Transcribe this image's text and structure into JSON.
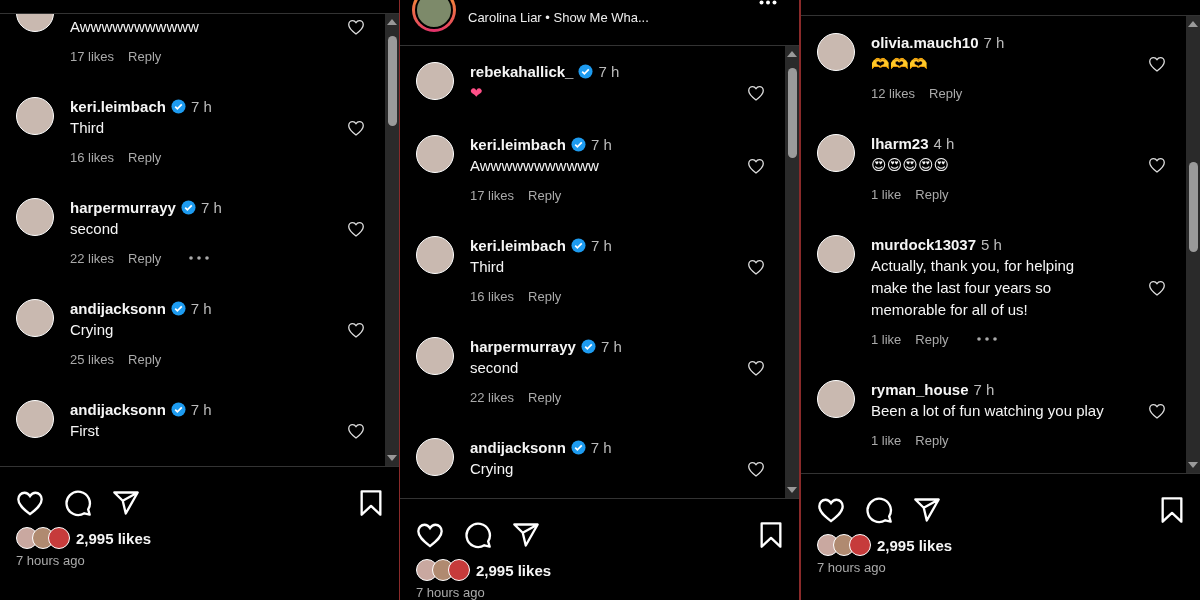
{
  "panels": [
    {
      "comments": [
        {
          "text": "Awwwwwwwwwww",
          "likes": "17 likes",
          "reply": "Reply",
          "more": false
        },
        {
          "user": "keri.leimbach",
          "verified": true,
          "time": "7 h",
          "text": "Third",
          "likes": "16 likes",
          "reply": "Reply",
          "more": false
        },
        {
          "user": "harpermurrayy",
          "verified": true,
          "time": "7 h",
          "text": "second",
          "likes": "22 likes",
          "reply": "Reply",
          "more": true
        },
        {
          "user": "andijacksonn",
          "verified": true,
          "time": "7 h",
          "text": "Crying",
          "likes": "25 likes",
          "reply": "Reply",
          "more": false
        },
        {
          "user": "andijacksonn",
          "verified": true,
          "time": "7 h",
          "text": "First"
        }
      ],
      "likes": "2,995 likes",
      "posted": "7 hours ago"
    },
    {
      "header": {
        "subtitle": "Carolina Liar • Show Me Wha..."
      },
      "comments": [
        {
          "user": "rebekahallick_",
          "verified": true,
          "time": "7 h",
          "text": "❤"
        },
        {
          "user": "keri.leimbach",
          "verified": true,
          "time": "7 h",
          "text": "Awwwwwwwwwww",
          "likes": "17 likes",
          "reply": "Reply",
          "more": false
        },
        {
          "user": "keri.leimbach",
          "verified": true,
          "time": "7 h",
          "text": "Third",
          "likes": "16 likes",
          "reply": "Reply",
          "more": false
        },
        {
          "user": "harpermurrayy",
          "verified": true,
          "time": "7 h",
          "text": "second",
          "likes": "22 likes",
          "reply": "Reply",
          "more": false
        },
        {
          "user": "andijacksonn",
          "verified": true,
          "time": "7 h",
          "text": "Crying"
        }
      ],
      "likes": "2,995 likes",
      "posted": "7 hours ago"
    },
    {
      "comments": [
        {
          "user": "olivia.mauch10",
          "verified": false,
          "time": "7 h",
          "text": "🫶🫶🫶",
          "likes": "12 likes",
          "reply": "Reply",
          "more": false
        },
        {
          "user": "lharm23",
          "verified": false,
          "time": "4 h",
          "text": "😍😍😍😍😍",
          "likes": "1 like",
          "reply": "Reply",
          "more": false
        },
        {
          "user": "murdock13037",
          "verified": false,
          "time": "5 h",
          "text": "Actually, thank you, for helping make the last four years so memorable for all of us!",
          "likes": "1 like",
          "reply": "Reply",
          "more": true
        },
        {
          "user": "ryman_house",
          "verified": false,
          "time": "7 h",
          "text": "Been a lot of fun watching you play",
          "likes": "1 like",
          "reply": "Reply",
          "more": false
        }
      ],
      "likes": "2,995 likes",
      "posted": "7 hours ago"
    }
  ]
}
